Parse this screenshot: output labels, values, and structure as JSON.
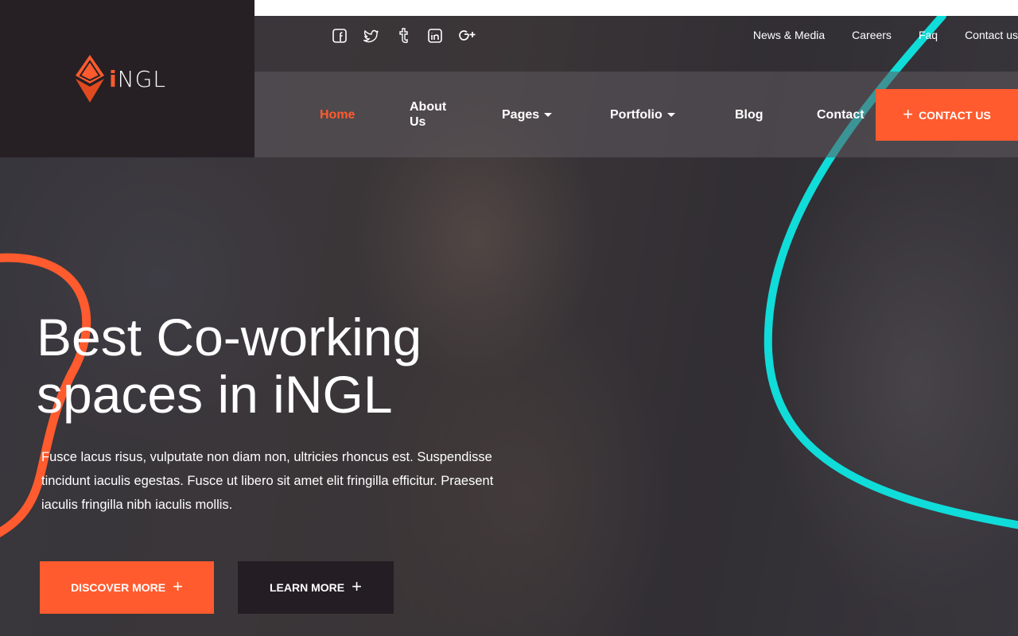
{
  "header": {
    "logo_letter": "i",
    "logo_rest": "NGL",
    "socials": [
      "facebook-icon",
      "twitter-icon",
      "tumblr-icon",
      "linkedin-icon",
      "google-plus-icon"
    ],
    "top_links": [
      "News & Media",
      "Careers",
      "Faq",
      "Contact us"
    ]
  },
  "nav": {
    "items": [
      "Home",
      "About Us",
      "Pages",
      "Portfolio",
      "Blog",
      "Contact"
    ],
    "active": "Home",
    "cta": "CONTACT US"
  },
  "hero": {
    "title": "Best Co-working spaces in iNGL",
    "text": "Fusce lacus risus, vulputate non diam non, ultricies rhoncus est. Suspendisse tincidunt iaculis egestas. Fusce ut libero sit amet elit fringilla efficitur. Praesent iaculis fringilla nibh iaculis mollis.",
    "btn_discover": "DISCOVER MORE",
    "btn_learn": "LEARN MORE",
    "plus": "+"
  },
  "colors": {
    "accent": "#ff5b2e",
    "teal": "#10dcd9",
    "dark": "#262024"
  }
}
